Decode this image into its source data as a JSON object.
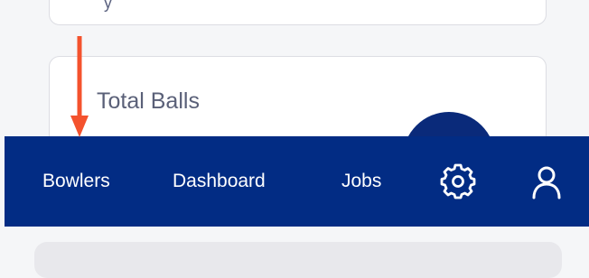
{
  "cards": {
    "top_card_partial_text": "y",
    "total_balls_title": "Total Balls"
  },
  "nav": {
    "items": [
      {
        "label": "Bowlers"
      },
      {
        "label": "Dashboard"
      },
      {
        "label": "Jobs"
      }
    ],
    "settings_icon": "gear-icon",
    "profile_icon": "user-icon"
  },
  "colors": {
    "nav_background": "#022c84",
    "fab_background": "#0a2a7a",
    "annotation_arrow": "#f4522d",
    "card_title_text": "#5a6078"
  }
}
